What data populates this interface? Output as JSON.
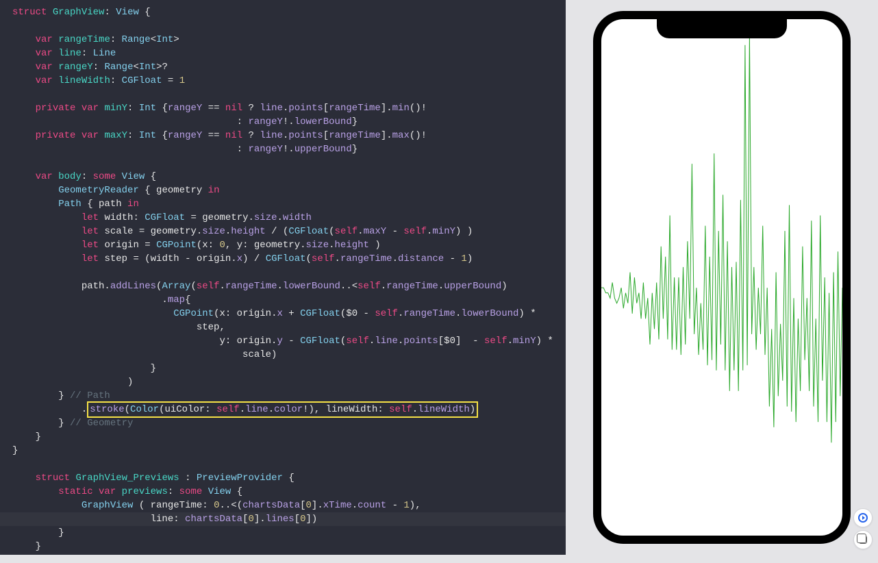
{
  "colors": {
    "editor_bg": "#2b2d38",
    "keyword": "#ec4a86",
    "type": "#84d1ee",
    "decl": "#49d7c6",
    "func": "#b9a1e6",
    "number": "#d6c78b",
    "comment": "#65737e",
    "plain": "#e6e6e6",
    "highlight_border": "#f5e146",
    "graph_stroke": "#2aa82a"
  },
  "code": {
    "lines": [
      [
        [
          "kw",
          "struct"
        ],
        [
          "plain",
          " "
        ],
        [
          "decl",
          "GraphView"
        ],
        [
          "plain",
          ": "
        ],
        [
          "type",
          "View"
        ],
        [
          "plain",
          " {"
        ]
      ],
      [],
      [
        [
          "plain",
          "    "
        ],
        [
          "kw",
          "var"
        ],
        [
          "plain",
          " "
        ],
        [
          "decl",
          "rangeTime"
        ],
        [
          "plain",
          ": "
        ],
        [
          "type",
          "Range"
        ],
        [
          "plain",
          "<"
        ],
        [
          "type",
          "Int"
        ],
        [
          "plain",
          ">"
        ]
      ],
      [
        [
          "plain",
          "    "
        ],
        [
          "kw",
          "var"
        ],
        [
          "plain",
          " "
        ],
        [
          "decl",
          "line"
        ],
        [
          "plain",
          ": "
        ],
        [
          "type",
          "Line"
        ]
      ],
      [
        [
          "plain",
          "    "
        ],
        [
          "kw",
          "var"
        ],
        [
          "plain",
          " "
        ],
        [
          "decl",
          "rangeY"
        ],
        [
          "plain",
          ": "
        ],
        [
          "type",
          "Range"
        ],
        [
          "plain",
          "<"
        ],
        [
          "type",
          "Int"
        ],
        [
          "plain",
          ">?"
        ]
      ],
      [
        [
          "plain",
          "    "
        ],
        [
          "kw",
          "var"
        ],
        [
          "plain",
          " "
        ],
        [
          "decl",
          "lineWidth"
        ],
        [
          "plain",
          ": "
        ],
        [
          "type",
          "CGFloat"
        ],
        [
          "plain",
          " = "
        ],
        [
          "num",
          "1"
        ]
      ],
      [],
      [
        [
          "plain",
          "    "
        ],
        [
          "kw",
          "private var"
        ],
        [
          "plain",
          " "
        ],
        [
          "decl",
          "minY"
        ],
        [
          "plain",
          ": "
        ],
        [
          "type",
          "Int"
        ],
        [
          "plain",
          " {"
        ],
        [
          "prop",
          "rangeY"
        ],
        [
          "plain",
          " == "
        ],
        [
          "kw",
          "nil"
        ],
        [
          "plain",
          " ? "
        ],
        [
          "prop",
          "line"
        ],
        [
          "plain",
          "."
        ],
        [
          "prop",
          "points"
        ],
        [
          "plain",
          "["
        ],
        [
          "prop",
          "rangeTime"
        ],
        [
          "plain",
          "]."
        ],
        [
          "fn",
          "min"
        ],
        [
          "plain",
          "()!"
        ]
      ],
      [
        [
          "plain",
          "                                       : "
        ],
        [
          "prop",
          "rangeY"
        ],
        [
          "plain",
          "!."
        ],
        [
          "prop",
          "lowerBound"
        ],
        [
          "plain",
          "}"
        ]
      ],
      [
        [
          "plain",
          "    "
        ],
        [
          "kw",
          "private var"
        ],
        [
          "plain",
          " "
        ],
        [
          "decl",
          "maxY"
        ],
        [
          "plain",
          ": "
        ],
        [
          "type",
          "Int"
        ],
        [
          "plain",
          " {"
        ],
        [
          "prop",
          "rangeY"
        ],
        [
          "plain",
          " == "
        ],
        [
          "kw",
          "nil"
        ],
        [
          "plain",
          " ? "
        ],
        [
          "prop",
          "line"
        ],
        [
          "plain",
          "."
        ],
        [
          "prop",
          "points"
        ],
        [
          "plain",
          "["
        ],
        [
          "prop",
          "rangeTime"
        ],
        [
          "plain",
          "]."
        ],
        [
          "fn",
          "max"
        ],
        [
          "plain",
          "()!"
        ]
      ],
      [
        [
          "plain",
          "                                       : "
        ],
        [
          "prop",
          "rangeY"
        ],
        [
          "plain",
          "!."
        ],
        [
          "prop",
          "upperBound"
        ],
        [
          "plain",
          "}"
        ]
      ],
      [],
      [
        [
          "plain",
          "    "
        ],
        [
          "kw",
          "var"
        ],
        [
          "plain",
          " "
        ],
        [
          "decl",
          "body"
        ],
        [
          "plain",
          ": "
        ],
        [
          "kw",
          "some"
        ],
        [
          "plain",
          " "
        ],
        [
          "type",
          "View"
        ],
        [
          "plain",
          " {"
        ]
      ],
      [
        [
          "plain",
          "        "
        ],
        [
          "type",
          "GeometryReader"
        ],
        [
          "plain",
          " { geometry "
        ],
        [
          "kw",
          "in"
        ]
      ],
      [
        [
          "plain",
          "        "
        ],
        [
          "type",
          "Path"
        ],
        [
          "plain",
          " { path "
        ],
        [
          "kw",
          "in"
        ]
      ],
      [
        [
          "plain",
          "            "
        ],
        [
          "kw",
          "let"
        ],
        [
          "plain",
          " width: "
        ],
        [
          "type",
          "CGFloat"
        ],
        [
          "plain",
          " = geometry."
        ],
        [
          "prop",
          "size"
        ],
        [
          "plain",
          "."
        ],
        [
          "prop",
          "width"
        ]
      ],
      [
        [
          "plain",
          "            "
        ],
        [
          "kw",
          "let"
        ],
        [
          "plain",
          " scale = geometry."
        ],
        [
          "prop",
          "size"
        ],
        [
          "plain",
          "."
        ],
        [
          "prop",
          "height"
        ],
        [
          "plain",
          " / ("
        ],
        [
          "type",
          "CGFloat"
        ],
        [
          "plain",
          "("
        ],
        [
          "kw",
          "self"
        ],
        [
          "plain",
          "."
        ],
        [
          "prop",
          "maxY"
        ],
        [
          "plain",
          " - "
        ],
        [
          "kw",
          "self"
        ],
        [
          "plain",
          "."
        ],
        [
          "prop",
          "minY"
        ],
        [
          "plain",
          ") )"
        ]
      ],
      [
        [
          "plain",
          "            "
        ],
        [
          "kw",
          "let"
        ],
        [
          "plain",
          " origin = "
        ],
        [
          "type",
          "CGPoint"
        ],
        [
          "plain",
          "(x: "
        ],
        [
          "num",
          "0"
        ],
        [
          "plain",
          ", y: geometry."
        ],
        [
          "prop",
          "size"
        ],
        [
          "plain",
          "."
        ],
        [
          "prop",
          "height"
        ],
        [
          "plain",
          " )"
        ]
      ],
      [
        [
          "plain",
          "            "
        ],
        [
          "kw",
          "let"
        ],
        [
          "plain",
          " step = (width - origin."
        ],
        [
          "prop",
          "x"
        ],
        [
          "plain",
          ") / "
        ],
        [
          "type",
          "CGFloat"
        ],
        [
          "plain",
          "("
        ],
        [
          "kw",
          "self"
        ],
        [
          "plain",
          "."
        ],
        [
          "prop",
          "rangeTime"
        ],
        [
          "plain",
          "."
        ],
        [
          "prop",
          "distance"
        ],
        [
          "plain",
          " - "
        ],
        [
          "num",
          "1"
        ],
        [
          "plain",
          ")"
        ]
      ],
      [],
      [
        [
          "plain",
          "            path."
        ],
        [
          "fn",
          "addLines"
        ],
        [
          "plain",
          "("
        ],
        [
          "type",
          "Array"
        ],
        [
          "plain",
          "("
        ],
        [
          "kw",
          "self"
        ],
        [
          "plain",
          "."
        ],
        [
          "prop",
          "rangeTime"
        ],
        [
          "plain",
          "."
        ],
        [
          "prop",
          "lowerBound"
        ],
        [
          "plain",
          "..<"
        ],
        [
          "kw",
          "self"
        ],
        [
          "plain",
          "."
        ],
        [
          "prop",
          "rangeTime"
        ],
        [
          "plain",
          "."
        ],
        [
          "prop",
          "upperBound"
        ],
        [
          "plain",
          ")"
        ]
      ],
      [
        [
          "plain",
          "                          ."
        ],
        [
          "fn",
          "map"
        ],
        [
          "plain",
          "{"
        ]
      ],
      [
        [
          "plain",
          "                            "
        ],
        [
          "type",
          "CGPoint"
        ],
        [
          "plain",
          "(x: origin."
        ],
        [
          "prop",
          "x"
        ],
        [
          "plain",
          " + "
        ],
        [
          "type",
          "CGFloat"
        ],
        [
          "plain",
          "($0 - "
        ],
        [
          "kw",
          "self"
        ],
        [
          "plain",
          "."
        ],
        [
          "prop",
          "rangeTime"
        ],
        [
          "plain",
          "."
        ],
        [
          "prop",
          "lowerBound"
        ],
        [
          "plain",
          ") *"
        ]
      ],
      [
        [
          "plain",
          "                                step,"
        ]
      ],
      [
        [
          "plain",
          "                                    y: origin."
        ],
        [
          "prop",
          "y"
        ],
        [
          "plain",
          " - "
        ],
        [
          "type",
          "CGFloat"
        ],
        [
          "plain",
          "("
        ],
        [
          "kw",
          "self"
        ],
        [
          "plain",
          "."
        ],
        [
          "prop",
          "line"
        ],
        [
          "plain",
          "."
        ],
        [
          "prop",
          "points"
        ],
        [
          "plain",
          "[$0]  - "
        ],
        [
          "kw",
          "self"
        ],
        [
          "plain",
          "."
        ],
        [
          "prop",
          "minY"
        ],
        [
          "plain",
          ") *"
        ]
      ],
      [
        [
          "plain",
          "                                        scale)"
        ]
      ],
      [
        [
          "plain",
          "                        }"
        ]
      ],
      [
        [
          "plain",
          "                    )"
        ]
      ],
      [
        [
          "plain",
          "        } "
        ],
        [
          "comment",
          "// Path"
        ]
      ],
      [
        [
          "plain",
          "            ."
        ],
        [
          "fn",
          "stroke"
        ],
        [
          "plain",
          "("
        ],
        [
          "type",
          "Color"
        ],
        [
          "plain",
          "(uiColor: "
        ],
        [
          "kw",
          "self"
        ],
        [
          "plain",
          "."
        ],
        [
          "prop",
          "line"
        ],
        [
          "plain",
          "."
        ],
        [
          "prop",
          "color"
        ],
        [
          "plain",
          "!), lineWidth: "
        ],
        [
          "kw",
          "self"
        ],
        [
          "plain",
          "."
        ],
        [
          "prop",
          "lineWidth"
        ],
        [
          "plain",
          ")"
        ]
      ],
      [
        [
          "plain",
          "        } "
        ],
        [
          "comment",
          "// Geometry"
        ]
      ],
      [
        [
          "plain",
          "    }"
        ]
      ],
      [
        [
          "plain",
          "}"
        ]
      ],
      [],
      [
        [
          "plain",
          "    "
        ],
        [
          "kw",
          "struct"
        ],
        [
          "plain",
          " "
        ],
        [
          "decl",
          "GraphView_Previews"
        ],
        [
          "plain",
          " : "
        ],
        [
          "type",
          "PreviewProvider"
        ],
        [
          "plain",
          " {"
        ]
      ],
      [
        [
          "plain",
          "        "
        ],
        [
          "kw",
          "static var"
        ],
        [
          "plain",
          " "
        ],
        [
          "decl",
          "previews"
        ],
        [
          "plain",
          ": "
        ],
        [
          "kw",
          "some"
        ],
        [
          "plain",
          " "
        ],
        [
          "type",
          "View"
        ],
        [
          "plain",
          " {"
        ]
      ],
      [
        [
          "plain",
          "            "
        ],
        [
          "type",
          "GraphView"
        ],
        [
          "plain",
          " ( rangeTime: "
        ],
        [
          "num",
          "0"
        ],
        [
          "plain",
          "..<("
        ],
        [
          "prop",
          "chartsData"
        ],
        [
          "plain",
          "["
        ],
        [
          "num",
          "0"
        ],
        [
          "plain",
          "]."
        ],
        [
          "prop",
          "xTime"
        ],
        [
          "plain",
          "."
        ],
        [
          "prop",
          "count"
        ],
        [
          "plain",
          " - "
        ],
        [
          "num",
          "1"
        ],
        [
          "plain",
          "),"
        ]
      ],
      [
        [
          "plain",
          "                        line: "
        ],
        [
          "prop",
          "chartsData"
        ],
        [
          "plain",
          "["
        ],
        [
          "num",
          "0"
        ],
        [
          "plain",
          "]."
        ],
        [
          "prop",
          "lines"
        ],
        [
          "plain",
          "["
        ],
        [
          "num",
          "0"
        ],
        [
          "plain",
          "])"
        ]
      ],
      [
        [
          "plain",
          "        }"
        ]
      ],
      [
        [
          "plain",
          "    }"
        ]
      ]
    ],
    "highlighted_line_index": 29,
    "selected_line_index": 37
  },
  "chart_data": {
    "type": "line",
    "stroke_color": "#2aa82a",
    "xlabel": "",
    "ylabel": "",
    "title": "",
    "x_range": [
      0,
      110
    ],
    "y_range": [
      0,
      100
    ],
    "values": [
      48,
      48,
      47,
      47,
      46,
      49,
      46,
      45,
      46,
      48,
      44,
      47,
      45,
      51,
      43,
      50,
      45,
      47,
      42,
      49,
      42,
      46,
      37,
      47,
      40,
      49,
      38,
      56,
      42,
      54,
      38,
      62,
      36,
      50,
      36,
      50,
      35,
      52,
      37,
      57,
      42,
      72,
      39,
      48,
      35,
      45,
      36,
      60,
      33,
      54,
      34,
      74,
      32,
      59,
      37,
      66,
      32,
      57,
      28,
      52,
      32,
      53,
      28,
      65,
      32,
      95,
      33,
      97,
      39,
      52,
      36,
      48,
      39,
      60,
      35,
      48,
      25,
      40,
      21,
      51,
      27,
      41,
      30,
      59,
      25,
      64,
      24,
      46,
      22,
      42,
      28,
      56,
      34,
      46,
      28,
      61,
      25,
      42,
      22,
      62,
      30,
      50,
      22,
      47,
      18,
      51,
      22,
      55,
      27,
      48
    ]
  },
  "preview_controls": {
    "play_label": "Live Preview",
    "duplicate_label": "Duplicate Preview"
  }
}
